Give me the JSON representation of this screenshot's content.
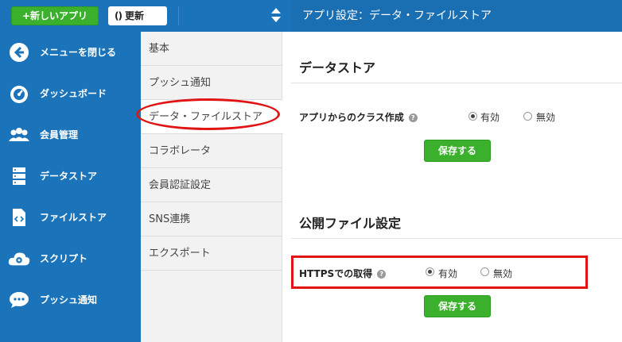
{
  "topbar": {
    "new_app_label": "+新しいアプリ",
    "refresh_icon": "()",
    "refresh_label": "更新",
    "breadcrumb": "アプリ設定：データ・ファイルストア"
  },
  "sidebar": {
    "items": [
      {
        "label": "メニューを閉じる",
        "icon": "back-arrow-icon"
      },
      {
        "label": "ダッシュボード",
        "icon": "dashboard-icon"
      },
      {
        "label": "会員管理",
        "icon": "users-icon"
      },
      {
        "label": "データストア",
        "icon": "database-icon"
      },
      {
        "label": "ファイルストア",
        "icon": "file-code-icon"
      },
      {
        "label": "スクリプト",
        "icon": "cloud-gear-icon"
      },
      {
        "label": "プッシュ通知",
        "icon": "chat-bubble-icon"
      }
    ]
  },
  "submenu": {
    "items": [
      {
        "label": "基本"
      },
      {
        "label": "プッシュ通知"
      },
      {
        "label": "データ・ファイルストア",
        "active": true
      },
      {
        "label": "コラボレータ"
      },
      {
        "label": "会員認証設定"
      },
      {
        "label": "SNS連携"
      },
      {
        "label": "エクスポート"
      }
    ]
  },
  "datastore": {
    "title": "データストア",
    "class_creation_label": "アプリからのクラス作成",
    "help_icon": "?",
    "enabled_label": "有効",
    "disabled_label": "無効",
    "selected": "有効",
    "save_label": "保存する"
  },
  "public_file": {
    "title": "公開ファイル設定",
    "https_label": "HTTPSでの取得",
    "help_icon": "?",
    "enabled_label": "有効",
    "disabled_label": "無効",
    "selected": "有効",
    "save_label": "保存する"
  },
  "colors": {
    "header_blue": "#1b74ba",
    "button_green": "#3bb02d",
    "highlight_red": "#e01414"
  }
}
